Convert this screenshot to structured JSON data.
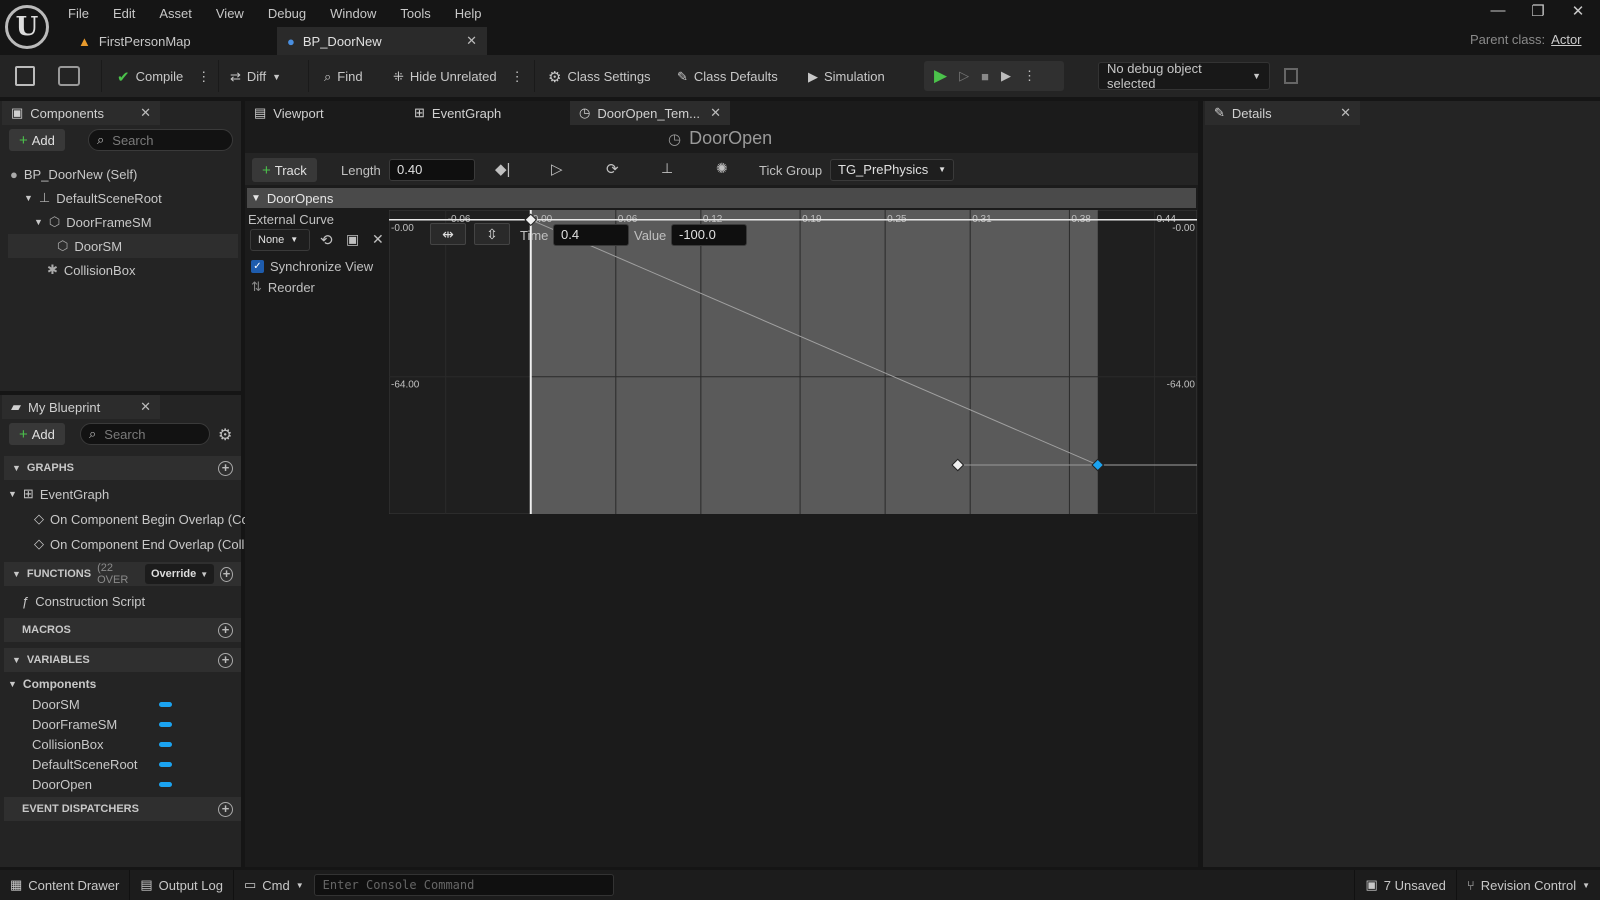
{
  "menu": [
    "File",
    "Edit",
    "Asset",
    "View",
    "Debug",
    "Window",
    "Tools",
    "Help"
  ],
  "doc_tabs": [
    {
      "label": "FirstPersonMap"
    },
    {
      "label": "BP_DoorNew"
    }
  ],
  "parent_class": {
    "label": "Parent class:",
    "value": "Actor"
  },
  "toolbar": {
    "compile": "Compile",
    "diff": "Diff",
    "find": "Find",
    "hide_unrelated": "Hide Unrelated",
    "class_settings": "Class Settings",
    "class_defaults": "Class Defaults",
    "simulation": "Simulation",
    "debug_object": "No debug object selected"
  },
  "components_panel": {
    "title": "Components",
    "add": "Add",
    "search_placeholder": "Search",
    "items": [
      "BP_DoorNew (Self)",
      "DefaultSceneRoot",
      "DoorFrameSM",
      "DoorSM",
      "CollisionBox"
    ]
  },
  "blueprint_panel": {
    "title": "My Blueprint",
    "add": "Add",
    "search_placeholder": "Search",
    "graphs": "GRAPHS",
    "event_graph": "EventGraph",
    "events": [
      "On Component Begin Overlap (Co",
      "On Component End Overlap (Colli"
    ],
    "functions": "FUNCTIONS",
    "functions_count": "(22 OVER",
    "override": "Override",
    "construction_script": "Construction Script",
    "macros": "MACROS",
    "variables": "VARIABLES",
    "var_category": "Components",
    "vars": [
      "DoorSM",
      "DoorFrameSM",
      "CollisionBox",
      "DefaultSceneRoot",
      "DoorOpen"
    ],
    "event_dispatchers": "EVENT DISPATCHERS",
    "var_color": "#1ba3f0"
  },
  "editor_tabs": [
    "Viewport",
    "EventGraph",
    "DoorOpen_Tem..."
  ],
  "timeline": {
    "name": "DoorOpen",
    "track_button": "Track",
    "length_label": "Length",
    "length_value": "0.40",
    "tick_group_label": "Tick Group",
    "tick_group_value": "TG_PrePhysics",
    "track_name": "DoorOpens",
    "external_curve": "External Curve",
    "curve_select": "None",
    "sync_view": "Synchronize View",
    "reorder": "Reorder",
    "time_label": "Time",
    "time_value": "0.4",
    "value_label": "Value",
    "value_value": "-100.0"
  },
  "curve_labels": {
    "x_ticks": [
      "-0.06",
      "0.00",
      "0.06",
      "0.12",
      "0.19",
      "0.25",
      "0.31",
      "0.38",
      "0.44"
    ],
    "y_left": [
      "-0.00",
      "-64.00"
    ],
    "y_right": [
      "-0.00",
      "-64.00"
    ]
  },
  "curve_data": {
    "keys": [
      {
        "time": 0.0,
        "value": 0.0
      },
      {
        "time": 0.4,
        "value": -100.0
      }
    ],
    "selected_key": 1,
    "time_range": [
      -0.1,
      0.47
    ],
    "value_range": [
      -120,
      4
    ]
  },
  "details": {
    "title": "Details"
  },
  "status": {
    "content_drawer": "Content Drawer",
    "output_log": "Output Log",
    "cmd": "Cmd",
    "console_placeholder": "Enter Console Command",
    "unsaved": "7 Unsaved",
    "revision_control": "Revision Control"
  }
}
